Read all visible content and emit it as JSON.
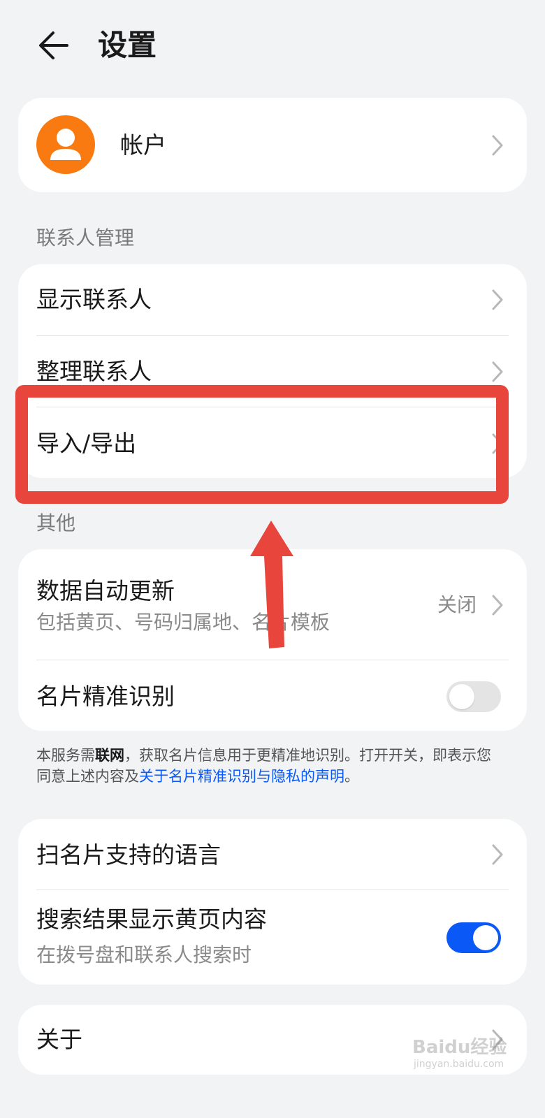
{
  "header": {
    "title": "设置",
    "back_icon": "arrow-left-icon"
  },
  "account": {
    "label": "帐户",
    "avatar_color": "#f97a10"
  },
  "contacts_section": {
    "title": "联系人管理",
    "items": [
      {
        "label": "显示联系人"
      },
      {
        "label": "整理联系人"
      },
      {
        "label": "导入/导出"
      }
    ]
  },
  "other_section": {
    "title": "其他",
    "auto_update": {
      "label": "数据自动更新",
      "sub": "包括黄页、号码归属地、名片模板",
      "value": "关闭"
    },
    "card_recognition": {
      "label": "名片精准识别",
      "enabled": false
    }
  },
  "note": {
    "part1": "本服务需",
    "bold": "联网",
    "part2": "，获取名片信息用于更精准地识别。打开开关，即表示您同意上述内容及",
    "link": "关于名片精准识别与隐私的声明",
    "part3": "。"
  },
  "scan_section": {
    "languages": {
      "label": "扫名片支持的语言"
    },
    "yellow_pages": {
      "label": "搜索结果显示黄页内容",
      "sub": "在拨号盘和联系人搜索时",
      "enabled": true
    }
  },
  "about": {
    "label": "关于"
  },
  "annotation": {
    "color": "#e8453c"
  },
  "watermark": {
    "text": "Baidu经验",
    "sub": "jingyan.baidu.com"
  }
}
